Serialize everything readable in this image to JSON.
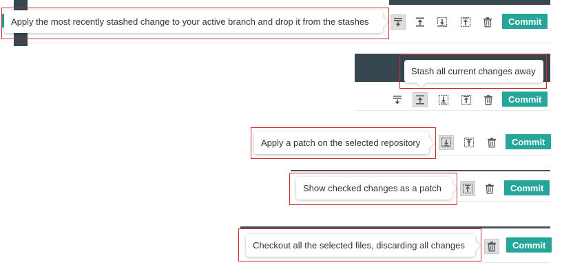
{
  "colors": {
    "toolbar_dark": "#37474f",
    "commit_bg": "#26a69a",
    "annotation_red": "#cc2a2a",
    "icon_gray": "#555555"
  },
  "tooltips": {
    "apply_stash": "Apply the most recently stashed change to your active branch and drop it from the stashes",
    "stash_all": "Stash all current changes away",
    "apply_patch": "Apply a patch on the selected repository",
    "show_patch": "Show checked changes as a patch",
    "checkout_all": "Checkout all the selected files, discarding all changes"
  },
  "toolbar": {
    "commit_label": "Commit",
    "icons": [
      "stash-pop-icon",
      "stash-icon",
      "apply-patch-icon",
      "create-patch-icon",
      "trash-icon"
    ]
  }
}
